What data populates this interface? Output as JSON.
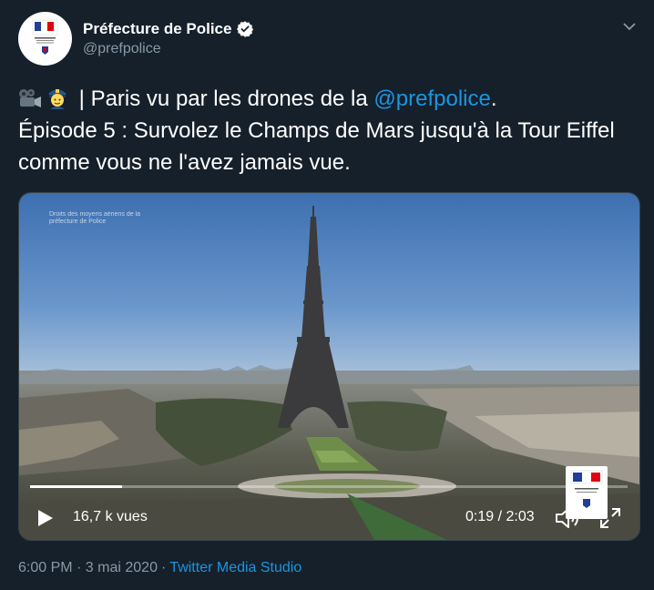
{
  "author": {
    "display_name": "Préfecture de Police",
    "handle": "@prefpolice",
    "avatar": "prefecture-logo",
    "verified_icon": "verified-badge-icon"
  },
  "tweet": {
    "emojis": [
      "movie-camera-emoji",
      "police-officer-emoji"
    ],
    "line1_prefix": "| Paris vu par les drones de la ",
    "mention": "@prefpolice",
    "line1_suffix": ".",
    "line2": "Épisode 5 : Survolez le Champs de Mars jusqu'à la Tour Eiffel comme vous ne l'avez jamais vue."
  },
  "video": {
    "credit": "Droits des moyens aériens de la préfecture de Police",
    "views": "16,7 k vues",
    "time": "0:19 / 2:03",
    "progress_fraction": 0.154,
    "controls": {
      "play": "play-icon",
      "volume": "volume-icon",
      "fullscreen": "fullscreen-icon"
    }
  },
  "footer": {
    "timestamp": "6:00 PM · 3 mai 2020",
    "separator": "·",
    "source": "Twitter Media Studio"
  },
  "colors": {
    "background": "#15202b",
    "link": "#1b95e0",
    "secondary_text": "#8899a6"
  }
}
